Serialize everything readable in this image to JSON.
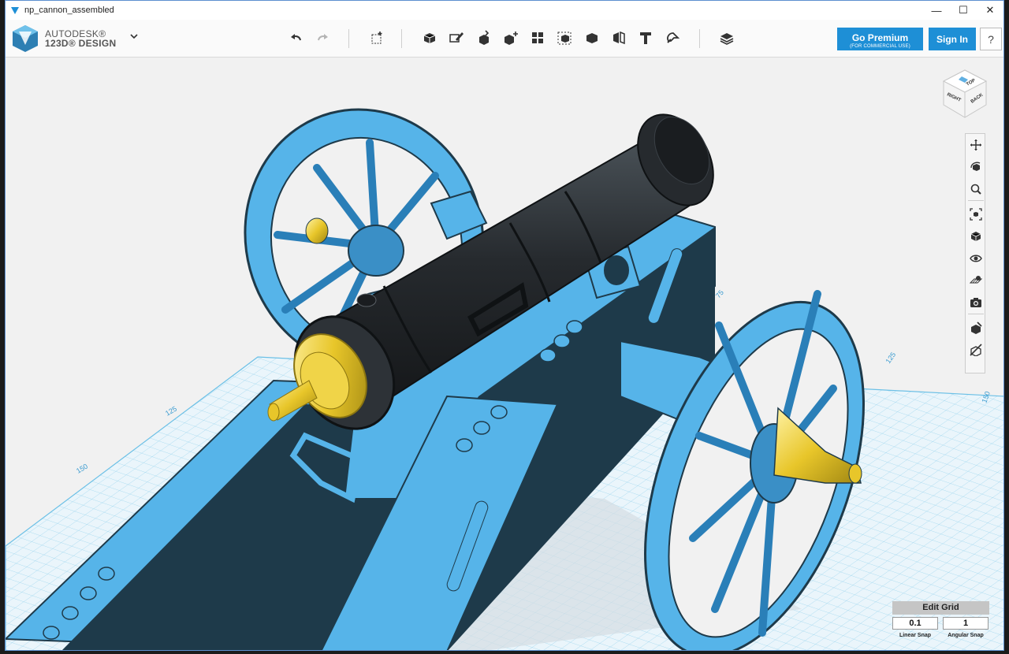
{
  "window": {
    "title": "np_cannon_assembled",
    "controls": [
      "—",
      "☐",
      "✕"
    ]
  },
  "brand": {
    "line1": "AUTODESK®",
    "line2": "123D® DESIGN"
  },
  "toolbar": {
    "tools": [
      "undo-icon",
      "redo-icon",
      "transform-icon",
      "primitives-icon",
      "sketch-icon",
      "construct-icon",
      "modify-icon",
      "pattern-icon",
      "grouping-icon",
      "combine-icon",
      "measure-icon",
      "text-icon",
      "snap-icon",
      "material-icon"
    ]
  },
  "premium": {
    "label": "Go Premium",
    "sublabel": "(FOR COMMERCIAL USE)"
  },
  "signin": {
    "label": "Sign In"
  },
  "help": {
    "label": "?"
  },
  "viewcube": {
    "top": "TOP",
    "right": "RIGHT",
    "back": "BACK"
  },
  "nav": [
    "pan-icon",
    "orbit-icon",
    "zoom-icon",
    "fit-icon",
    "view-icon",
    "visibility-icon",
    "grid-toggle-icon",
    "camera-icon",
    "material-display-icon",
    "hide-icon"
  ],
  "grid": {
    "edit_label": "Edit Grid",
    "linear_value": "0.1",
    "angular_value": "1",
    "linear_label": "Linear Snap",
    "angular_label": "Angular Snap",
    "ticks": [
      "125",
      "150",
      "75",
      "125",
      "150"
    ]
  },
  "colors": {
    "model_blue": "#56b4e9",
    "model_dark": "#1e3a4a",
    "barrel": "#262a2e",
    "brass": "#e8c62a",
    "grid_line": "#8fd0ec",
    "accent": "#1e8fd6"
  }
}
